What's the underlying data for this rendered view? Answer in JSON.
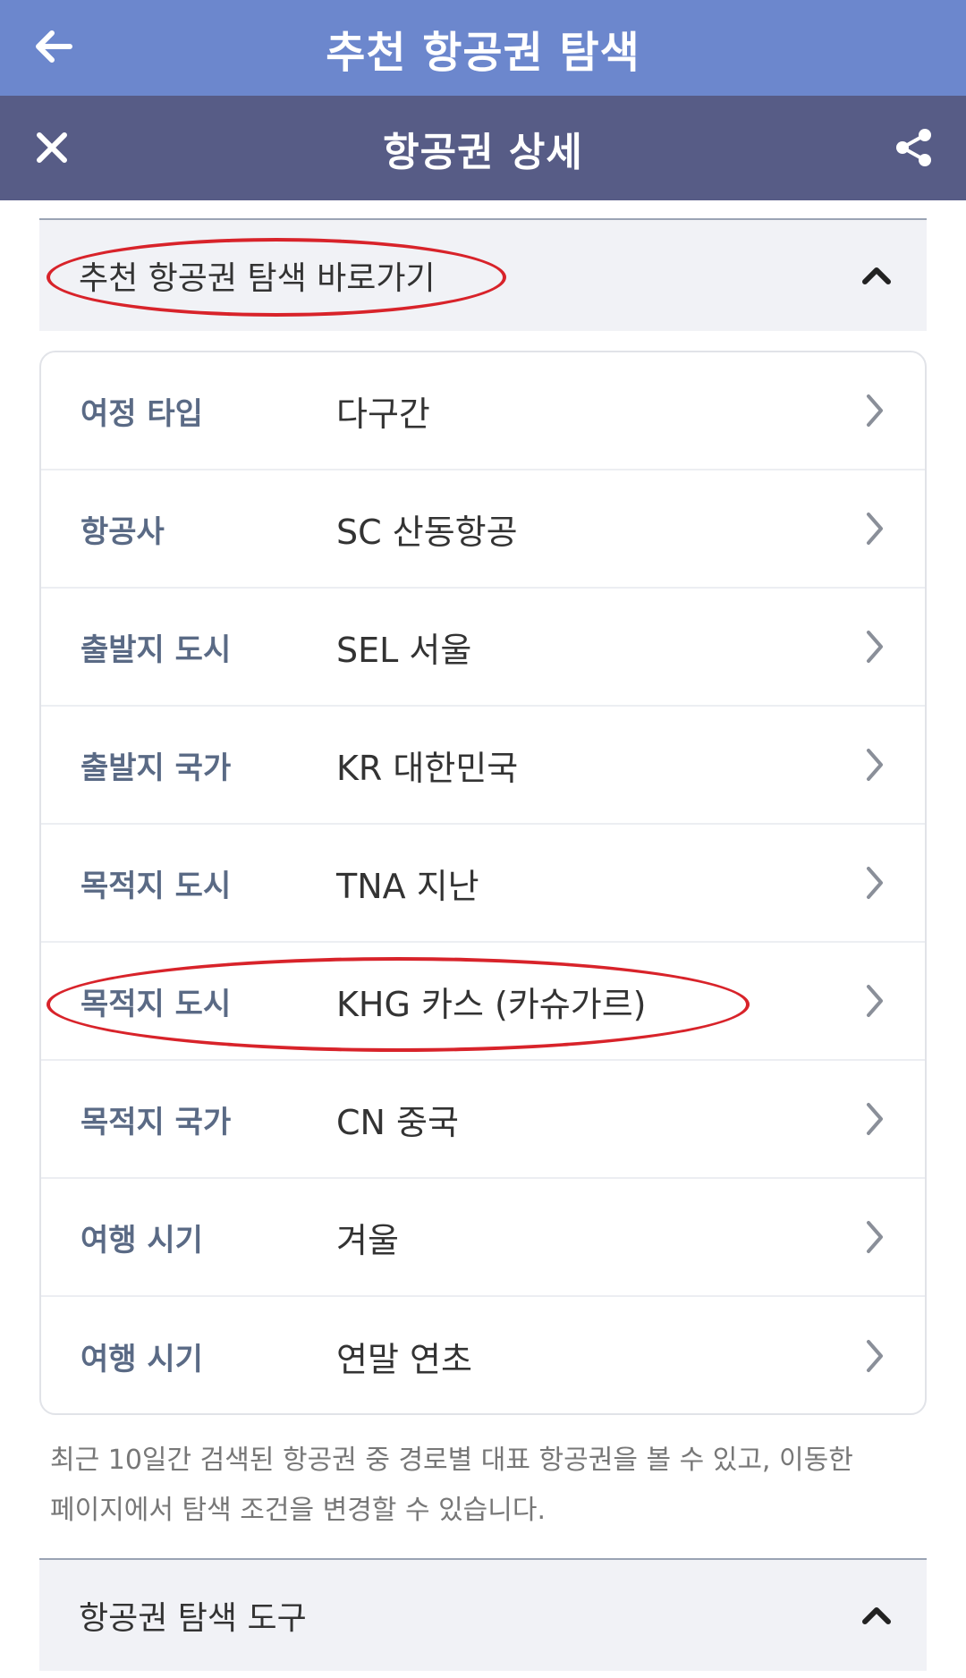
{
  "topbar": {
    "title": "추천 항공권 탐색",
    "back_icon": "arrow-left-icon"
  },
  "subbar": {
    "title": "항공권 상세",
    "close_icon": "close-icon",
    "share_icon": "share-icon"
  },
  "section_shortcut": {
    "label": "추천 항공권 탐색 바로가기",
    "state": "expanded"
  },
  "details": {
    "rows": [
      {
        "key": "여정 타입",
        "value": "다구간"
      },
      {
        "key": "항공사",
        "value": "SC 산동항공"
      },
      {
        "key": "출발지 도시",
        "value": "SEL 서울"
      },
      {
        "key": "출발지 국가",
        "value": "KR 대한민국"
      },
      {
        "key": "목적지 도시",
        "value": "TNA 지난"
      },
      {
        "key": "목적지 도시",
        "value": "KHG 카스 (카슈가르)"
      },
      {
        "key": "목적지 국가",
        "value": "CN 중국"
      },
      {
        "key": "여행 시기",
        "value": "겨울"
      },
      {
        "key": "여행 시기",
        "value": "연말 연초"
      }
    ]
  },
  "note": {
    "line1": "최근 10일간 검색된 항공권 중 경로별 대표 항공권을 볼 수 있고, 이동한",
    "line2": "페이지에서 탐색 조건을 변경할 수 있습니다."
  },
  "section_tools": {
    "label": "항공권 탐색 도구",
    "state": "expanded"
  },
  "colors": {
    "topbar": "#6c87cd",
    "subbar": "#575c86",
    "highlight_ellipse": "#d8232a",
    "key_text": "#5a6a85"
  }
}
